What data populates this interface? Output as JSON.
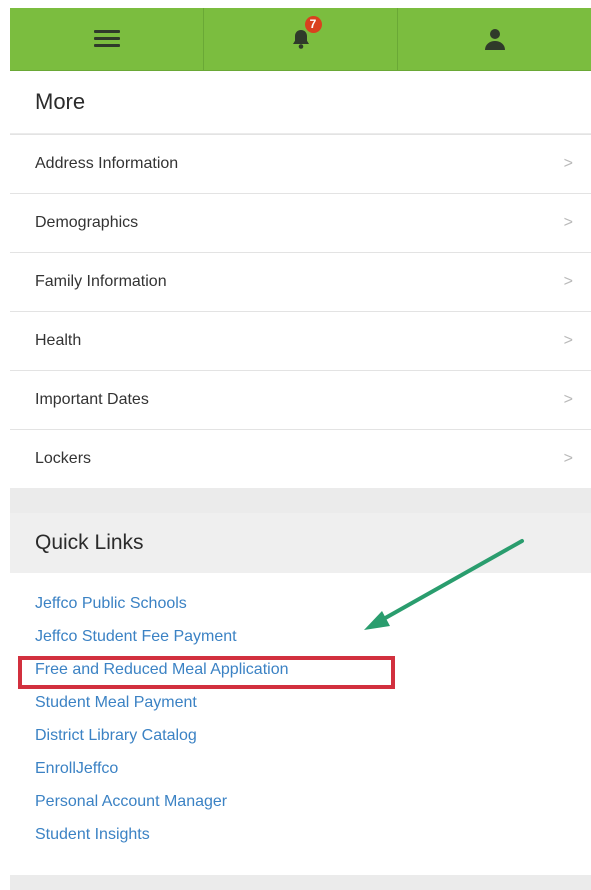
{
  "topbar": {
    "menu_icon": "hamburger-icon",
    "notification_icon": "bell-icon",
    "notification_count": "7",
    "profile_icon": "user-icon",
    "color": "#7bbd3f"
  },
  "more": {
    "title": "More",
    "items": [
      {
        "label": "Address Information",
        "chevron": ">"
      },
      {
        "label": "Demographics",
        "chevron": ">"
      },
      {
        "label": "Family Information",
        "chevron": ">"
      },
      {
        "label": "Health",
        "chevron": ">"
      },
      {
        "label": "Important Dates",
        "chevron": ">"
      },
      {
        "label": "Lockers",
        "chevron": ">"
      }
    ]
  },
  "quick_links": {
    "title": "Quick Links",
    "links": [
      "Jeffco Public Schools",
      "Jeffco Student Fee Payment",
      "Free and Reduced Meal Application",
      "Student Meal Payment",
      "District Library Catalog",
      "EnrollJeffco",
      "Personal Account Manager",
      "Student Insights"
    ],
    "link_color": "#3b82c4",
    "highlight_color": "#d2303e",
    "arrow_color": "#2a9d6e"
  }
}
